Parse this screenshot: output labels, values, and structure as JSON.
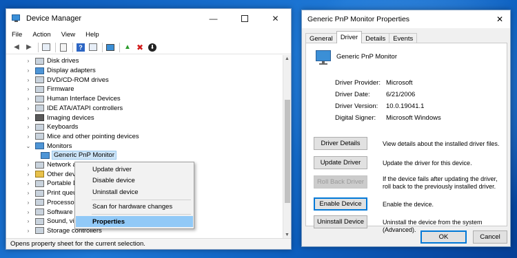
{
  "device_manager": {
    "title": "Device Manager",
    "controls": {
      "minimize": "—",
      "close": "✕"
    },
    "menu": [
      "File",
      "Action",
      "View",
      "Help"
    ],
    "tree": [
      {
        "label": "Disk drives",
        "icon": "disk-drive-icon",
        "expanded": false
      },
      {
        "label": "Display adapters",
        "icon": "display-adapter-icon",
        "expanded": false
      },
      {
        "label": "DVD/CD-ROM drives",
        "icon": "dvd-drive-icon",
        "expanded": false
      },
      {
        "label": "Firmware",
        "icon": "firmware-icon",
        "expanded": false
      },
      {
        "label": "Human Interface Devices",
        "icon": "hid-icon",
        "expanded": false
      },
      {
        "label": "IDE ATA/ATAPI controllers",
        "icon": "ide-controller-icon",
        "expanded": false
      },
      {
        "label": "Imaging devices",
        "icon": "camera-icon",
        "expanded": false
      },
      {
        "label": "Keyboards",
        "icon": "keyboard-icon",
        "expanded": false
      },
      {
        "label": "Mice and other pointing devices",
        "icon": "mouse-icon",
        "expanded": false
      },
      {
        "label": "Monitors",
        "icon": "monitor-icon",
        "expanded": true
      },
      {
        "label": "Generic PnP Monitor",
        "icon": "monitor-icon",
        "child": true,
        "selected": true
      },
      {
        "label": "Network adapters",
        "icon": "network-adapter-icon",
        "expanded": false
      },
      {
        "label": "Other devices",
        "icon": "other-device-icon",
        "expanded": false
      },
      {
        "label": "Portable Devices",
        "icon": "portable-device-icon",
        "expanded": false
      },
      {
        "label": "Print queues",
        "icon": "printer-icon",
        "expanded": false
      },
      {
        "label": "Processors",
        "icon": "processor-icon",
        "expanded": false
      },
      {
        "label": "Software devices",
        "icon": "software-device-icon",
        "expanded": false
      },
      {
        "label": "Sound, video and game controllers",
        "icon": "sound-icon",
        "expanded": false
      },
      {
        "label": "Storage controllers",
        "icon": "storage-controller-icon",
        "expanded": false
      }
    ],
    "status": "Opens property sheet for the current selection."
  },
  "context_menu": {
    "items": [
      "Update driver",
      "Disable device",
      "Uninstall device",
      "Scan for hardware changes",
      "Properties"
    ],
    "highlighted": "Properties"
  },
  "properties": {
    "title": "Generic PnP Monitor Properties",
    "tabs": [
      "General",
      "Driver",
      "Details",
      "Events"
    ],
    "active_tab": "Driver",
    "device_name": "Generic PnP Monitor",
    "info": [
      {
        "key": "Driver Provider:",
        "value": "Microsoft"
      },
      {
        "key": "Driver Date:",
        "value": "6/21/2006"
      },
      {
        "key": "Driver Version:",
        "value": "10.0.19041.1"
      },
      {
        "key": "Digital Signer:",
        "value": "Microsoft Windows"
      }
    ],
    "actions": [
      {
        "button": "Driver Details",
        "description": "View details about the installed driver files."
      },
      {
        "button": "Update Driver",
        "description": "Update the driver for this device."
      },
      {
        "button": "Roll Back Driver",
        "description": "If the device fails after updating the driver, roll back to the previously installed driver.",
        "disabled": true
      },
      {
        "button": "Enable Device",
        "description": "Enable the device."
      },
      {
        "button": "Uninstall Device",
        "description": "Uninstall the device from the system (Advanced)."
      }
    ],
    "ok": "OK",
    "cancel": "Cancel",
    "close": "✕"
  }
}
